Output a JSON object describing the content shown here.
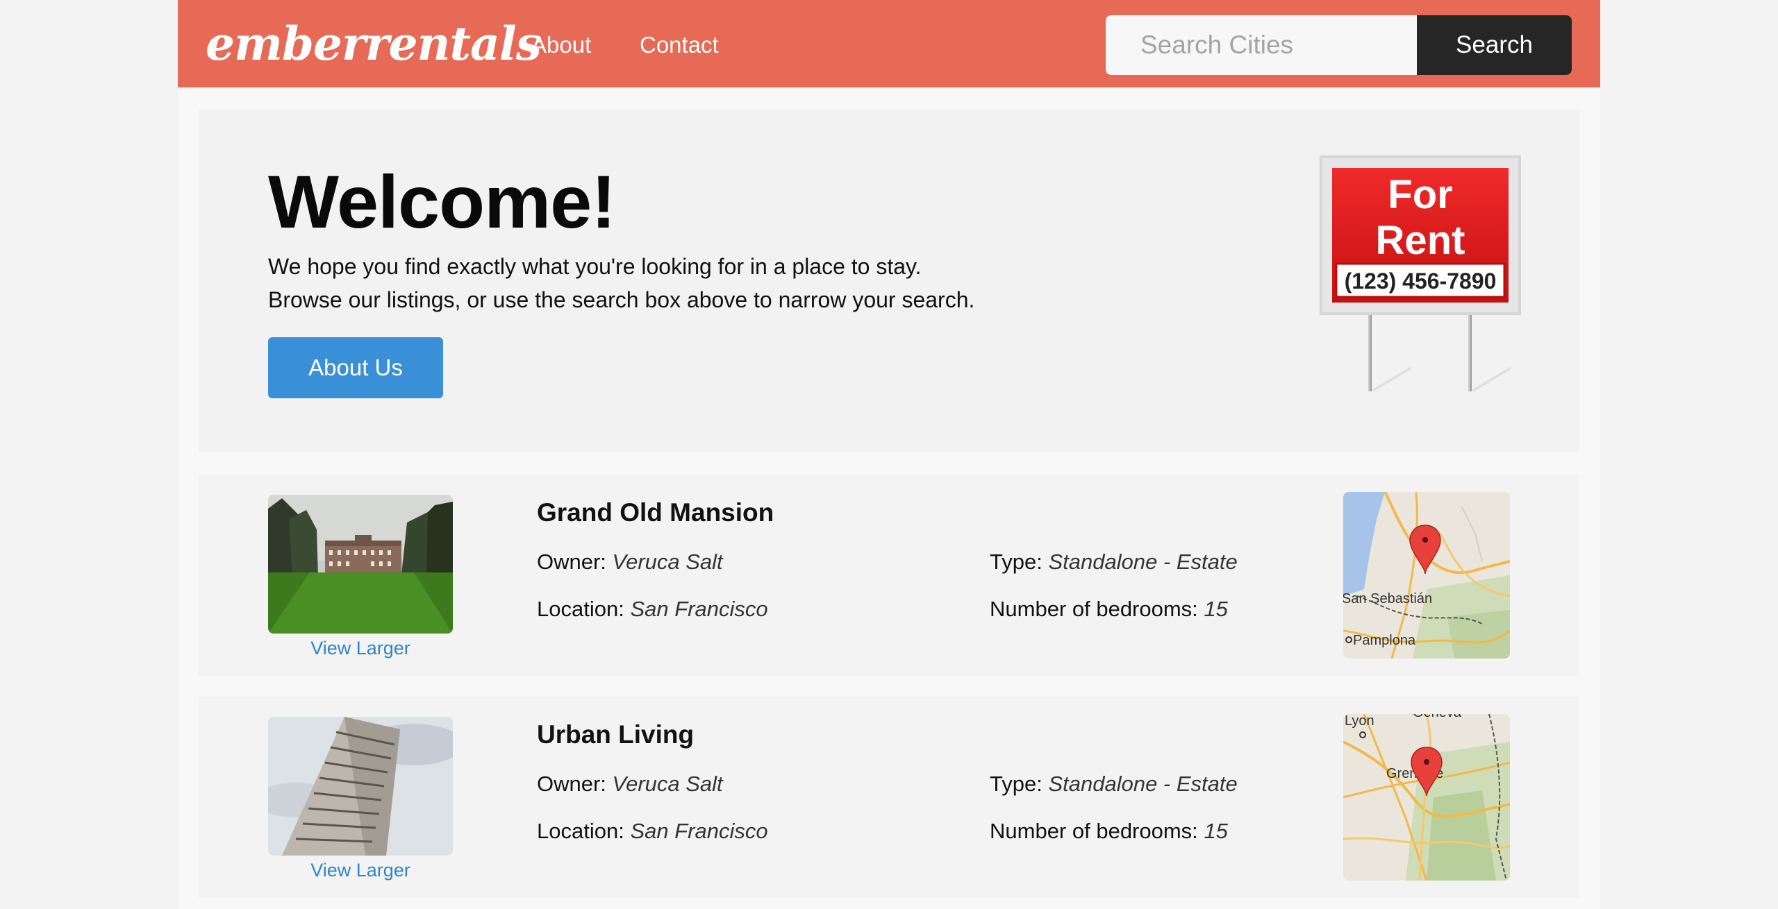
{
  "nav": {
    "logo": "emberrentals",
    "links": [
      "About",
      "Contact"
    ],
    "search_placeholder": "Search Cities",
    "search_button": "Search"
  },
  "jumbo": {
    "title": "Welcome!",
    "lines": [
      "We hope you find exactly what you're looking for in a place to stay.",
      "Browse our listings, or use the search box above to narrow your search."
    ],
    "button": "About Us",
    "sign": {
      "line1": "For",
      "line2": "Rent",
      "phone": "(123) 456-7890"
    }
  },
  "listings": [
    {
      "title": "Grand Old Mansion",
      "owner_label": "Owner:",
      "owner": "Veruca Salt",
      "location_label": "Location:",
      "location": "San Francisco",
      "type_label": "Type:",
      "type": "Standalone - Estate",
      "bedrooms_label": "Number of bedrooms:",
      "bedrooms": "15",
      "view_larger": "View Larger",
      "map_labels": [
        "San Sebastián",
        "Pamplona"
      ]
    },
    {
      "title": "Urban Living",
      "owner_label": "Owner:",
      "owner": "Veruca Salt",
      "location_label": "Location:",
      "location": "San Francisco",
      "type_label": "Type:",
      "type": "Standalone - Estate",
      "bedrooms_label": "Number of bedrooms:",
      "bedrooms": "15",
      "view_larger": "View Larger",
      "map_labels": [
        "Lyon",
        "Geneva",
        "Grenoble"
      ]
    }
  ],
  "colors": {
    "navbar": "#e66a56",
    "search_button": "#262626",
    "about_button": "#3a90d7",
    "link": "#2f86c8",
    "sign_red": "#e01c1c"
  }
}
